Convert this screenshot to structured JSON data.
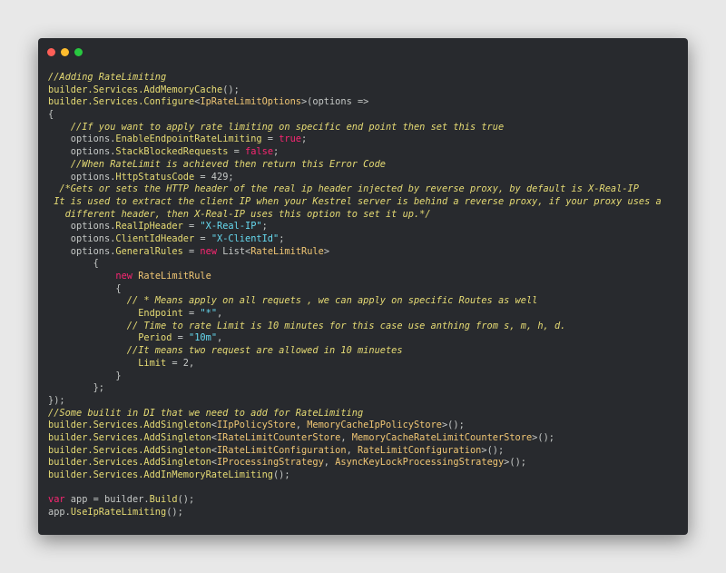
{
  "window": {
    "controls": [
      "close",
      "minimize",
      "maximize"
    ]
  },
  "colors": {
    "window_bg": "#282a2e",
    "page_bg": "#e8e8e8",
    "comment": "#e6db74",
    "keyword": "#f92672",
    "string": "#66d9ef",
    "plain": "#c5c8c6"
  },
  "code_lines": [
    [
      [
        "comment",
        "//Adding RateLimiting"
      ]
    ],
    [
      [
        "member",
        "builder.Services.AddMemoryCache"
      ],
      [
        "plain",
        "();"
      ]
    ],
    [
      [
        "member",
        "builder.Services.Configure"
      ],
      [
        "plain",
        "<"
      ],
      [
        "type",
        "IpRateLimitOptions"
      ],
      [
        "plain",
        ">(options =>"
      ]
    ],
    [
      [
        "plain",
        "{"
      ]
    ],
    [
      [
        "plain",
        "    "
      ],
      [
        "comment",
        "//If you want to apply rate limiting on specific end point then set this true"
      ]
    ],
    [
      [
        "plain",
        "    options."
      ],
      [
        "member",
        "EnableEndpointRateLimiting"
      ],
      [
        "plain",
        " = "
      ],
      [
        "keyword",
        "true"
      ],
      [
        "plain",
        ";"
      ]
    ],
    [
      [
        "plain",
        "    options."
      ],
      [
        "member",
        "StackBlockedRequests"
      ],
      [
        "plain",
        " = "
      ],
      [
        "keyword",
        "false"
      ],
      [
        "plain",
        ";"
      ]
    ],
    [
      [
        "plain",
        "    "
      ],
      [
        "comment",
        "//When RateLimit is achieved then return this Error Code"
      ]
    ],
    [
      [
        "plain",
        "    options."
      ],
      [
        "member",
        "HttpStatusCode"
      ],
      [
        "plain",
        " = 429;"
      ]
    ],
    [
      [
        "plain",
        "  "
      ],
      [
        "comment",
        "/*Gets or sets the HTTP header of the real ip header injected by reverse proxy, by default is X-Real-IP"
      ]
    ],
    [
      [
        "plain",
        " "
      ],
      [
        "comment",
        "It is used to extract the client IP when your Kestrel server is behind a reverse proxy, if your proxy uses a"
      ]
    ],
    [
      [
        "plain",
        "   "
      ],
      [
        "comment",
        "different header, then X-Real-IP uses this option to set it up.*/"
      ]
    ],
    [
      [
        "plain",
        "    options."
      ],
      [
        "member",
        "RealIpHeader"
      ],
      [
        "plain",
        " = "
      ],
      [
        "string",
        "\"X-Real-IP\""
      ],
      [
        "plain",
        ";"
      ]
    ],
    [
      [
        "plain",
        "    options."
      ],
      [
        "member",
        "ClientIdHeader"
      ],
      [
        "plain",
        " = "
      ],
      [
        "string",
        "\"X-ClientId\""
      ],
      [
        "plain",
        ";"
      ]
    ],
    [
      [
        "plain",
        "    options."
      ],
      [
        "member",
        "GeneralRules"
      ],
      [
        "plain",
        " = "
      ],
      [
        "keyword",
        "new"
      ],
      [
        "plain",
        " List<"
      ],
      [
        "type",
        "RateLimitRule"
      ],
      [
        "plain",
        ">"
      ]
    ],
    [
      [
        "plain",
        "        {"
      ]
    ],
    [
      [
        "plain",
        "            "
      ],
      [
        "keyword",
        "new"
      ],
      [
        "plain",
        " "
      ],
      [
        "type",
        "RateLimitRule"
      ]
    ],
    [
      [
        "plain",
        "            {"
      ]
    ],
    [
      [
        "plain",
        "              "
      ],
      [
        "comment",
        "// * Means apply on all requets , we can apply on specific Routes as well"
      ]
    ],
    [
      [
        "plain",
        "                "
      ],
      [
        "member",
        "Endpoint"
      ],
      [
        "plain",
        " = "
      ],
      [
        "string",
        "\"*\""
      ],
      [
        "plain",
        ","
      ]
    ],
    [
      [
        "plain",
        "              "
      ],
      [
        "comment",
        "// Time to rate Limit is 10 minutes for this case use anthing from s, m, h, d."
      ]
    ],
    [
      [
        "plain",
        "                "
      ],
      [
        "member",
        "Period"
      ],
      [
        "plain",
        " = "
      ],
      [
        "string",
        "\"10m\""
      ],
      [
        "plain",
        ","
      ]
    ],
    [
      [
        "plain",
        "              "
      ],
      [
        "comment",
        "//It means two request are allowed in 10 minuetes"
      ]
    ],
    [
      [
        "plain",
        "                "
      ],
      [
        "member",
        "Limit"
      ],
      [
        "plain",
        " = 2,"
      ]
    ],
    [
      [
        "plain",
        "            }"
      ]
    ],
    [
      [
        "plain",
        "        };"
      ]
    ],
    [
      [
        "plain",
        "});"
      ]
    ],
    [
      [
        "comment",
        "//Some builit in DI that we need to add for RateLimiting"
      ]
    ],
    [
      [
        "member",
        "builder.Services.AddSingleton"
      ],
      [
        "plain",
        "<"
      ],
      [
        "type",
        "IIpPolicyStore"
      ],
      [
        "plain",
        ", "
      ],
      [
        "type",
        "MemoryCacheIpPolicyStore"
      ],
      [
        "plain",
        ">();"
      ]
    ],
    [
      [
        "member",
        "builder.Services.AddSingleton"
      ],
      [
        "plain",
        "<"
      ],
      [
        "type",
        "IRateLimitCounterStore"
      ],
      [
        "plain",
        ", "
      ],
      [
        "type",
        "MemoryCacheRateLimitCounterStore"
      ],
      [
        "plain",
        ">();"
      ]
    ],
    [
      [
        "member",
        "builder.Services.AddSingleton"
      ],
      [
        "plain",
        "<"
      ],
      [
        "type",
        "IRateLimitConfiguration"
      ],
      [
        "plain",
        ", "
      ],
      [
        "type",
        "RateLimitConfiguration"
      ],
      [
        "plain",
        ">();"
      ]
    ],
    [
      [
        "member",
        "builder.Services.AddSingleton"
      ],
      [
        "plain",
        "<"
      ],
      [
        "type",
        "IProcessingStrategy"
      ],
      [
        "plain",
        ", "
      ],
      [
        "type",
        "AsyncKeyLockProcessingStrategy"
      ],
      [
        "plain",
        ">();"
      ]
    ],
    [
      [
        "member",
        "builder.Services.AddInMemoryRateLimiting"
      ],
      [
        "plain",
        "();"
      ]
    ],
    [
      [
        "plain",
        ""
      ]
    ],
    [
      [
        "keyword",
        "var"
      ],
      [
        "plain",
        " app = builder."
      ],
      [
        "member",
        "Build"
      ],
      [
        "plain",
        "();"
      ]
    ],
    [
      [
        "plain",
        "app."
      ],
      [
        "member",
        "UseIpRateLimiting"
      ],
      [
        "plain",
        "();"
      ]
    ]
  ]
}
